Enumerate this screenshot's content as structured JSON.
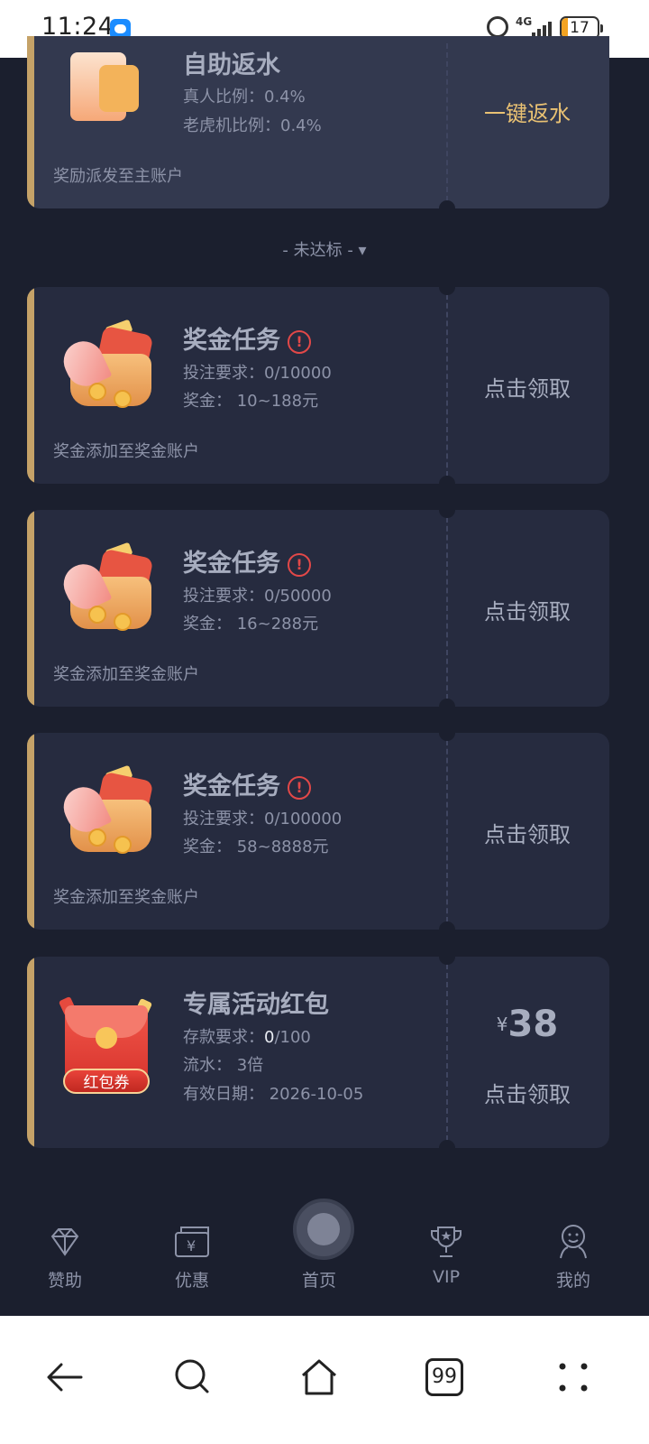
{
  "status_bar": {
    "time": "11:24",
    "network": "4G",
    "battery": "17",
    "battery_level": 0.17
  },
  "rebate_card": {
    "title": "自助返水",
    "line1": "真人比例：0.4%",
    "line2": "老虎机比例：0.4%",
    "footer": "奖励派发至主账户",
    "action": "一键返水"
  },
  "section_toggle": "- 未达标 - ▾",
  "tasks": [
    {
      "title": "奖金任务",
      "req_label": "投注要求：",
      "req_value": "0/10000",
      "bonus": "奖金：  10~188元",
      "footer": "奖金添加至奖金账户",
      "action": "点击领取"
    },
    {
      "title": "奖金任务",
      "req_label": "投注要求：",
      "req_value": "0/50000",
      "bonus": "奖金：  16~288元",
      "footer": "奖金添加至奖金账户",
      "action": "点击领取"
    },
    {
      "title": "奖金任务",
      "req_label": "投注要求：",
      "req_value": "0/100000",
      "bonus": "奖金：  58~8888元",
      "footer": "奖金添加至奖金账户",
      "action": "点击领取"
    }
  ],
  "redpacket_card": {
    "title": "专属活动红包",
    "deposit_label": "存款要求：",
    "deposit_done": "0",
    "deposit_total": "/100",
    "turnover": "流水：  3倍",
    "validity": "有效日期：  2026-10-05",
    "badge": "红包券",
    "currency": "¥",
    "amount": "38",
    "action": "点击领取"
  },
  "bottom_nav": [
    {
      "label": "赞助",
      "icon": "diamond-icon"
    },
    {
      "label": "优惠",
      "icon": "coupon-icon"
    },
    {
      "label": "首页",
      "icon": "soccer-ball-icon"
    },
    {
      "label": "VIP",
      "icon": "trophy-icon"
    },
    {
      "label": "我的",
      "icon": "profile-icon"
    }
  ],
  "system_nav": {
    "tabs_count": "99"
  },
  "colors": {
    "background": "#1b1f2e",
    "card": "#262b3f",
    "accent_gold": "#c5a268",
    "action_gold": "#e9c173",
    "warning_red": "#e24848"
  }
}
